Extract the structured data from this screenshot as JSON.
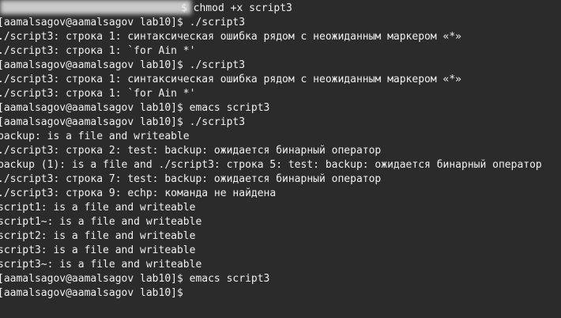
{
  "terminal": {
    "lines": [
      "$ chmod +x script3",
      "[aamalsagov@aamalsagov lab10]$ ./script3",
      "./script3: строка 1: синтаксическая ошибка рядом с неожиданным маркером «*»",
      "./script3: строка 1: `for Ain *'",
      "[aamalsagov@aamalsagov lab10]$ ./script3",
      "./script3: строка 1: синтаксическая ошибка рядом с неожиданным маркером «*»",
      "./script3: строка 1: `for Ain *'",
      "[aamalsagov@aamalsagov lab10]$ emacs script3",
      "[aamalsagov@aamalsagov lab10]$ ./script3",
      "backup: is a file and writeable",
      "./script3: строка 2: test: backup: ожидается бинарный оператор",
      "backup (1): is a file and ./script3: строка 5: test: backup: ожидается бинарный оператор",
      "./script3: строка 7: test: backup: ожидается бинарный оператор",
      "./script3: строка 9: echp: команда не найдена",
      "script1: is a file and writeable",
      "script1~: is a file and writeable",
      "script2: is a file and writeable",
      "script3: is a file and writeable",
      "script3~: is a file and writeable",
      "[aamalsagov@aamalsagov lab10]$ emacs script3",
      "[aamalsagov@aamalsagov lab10]$"
    ]
  }
}
